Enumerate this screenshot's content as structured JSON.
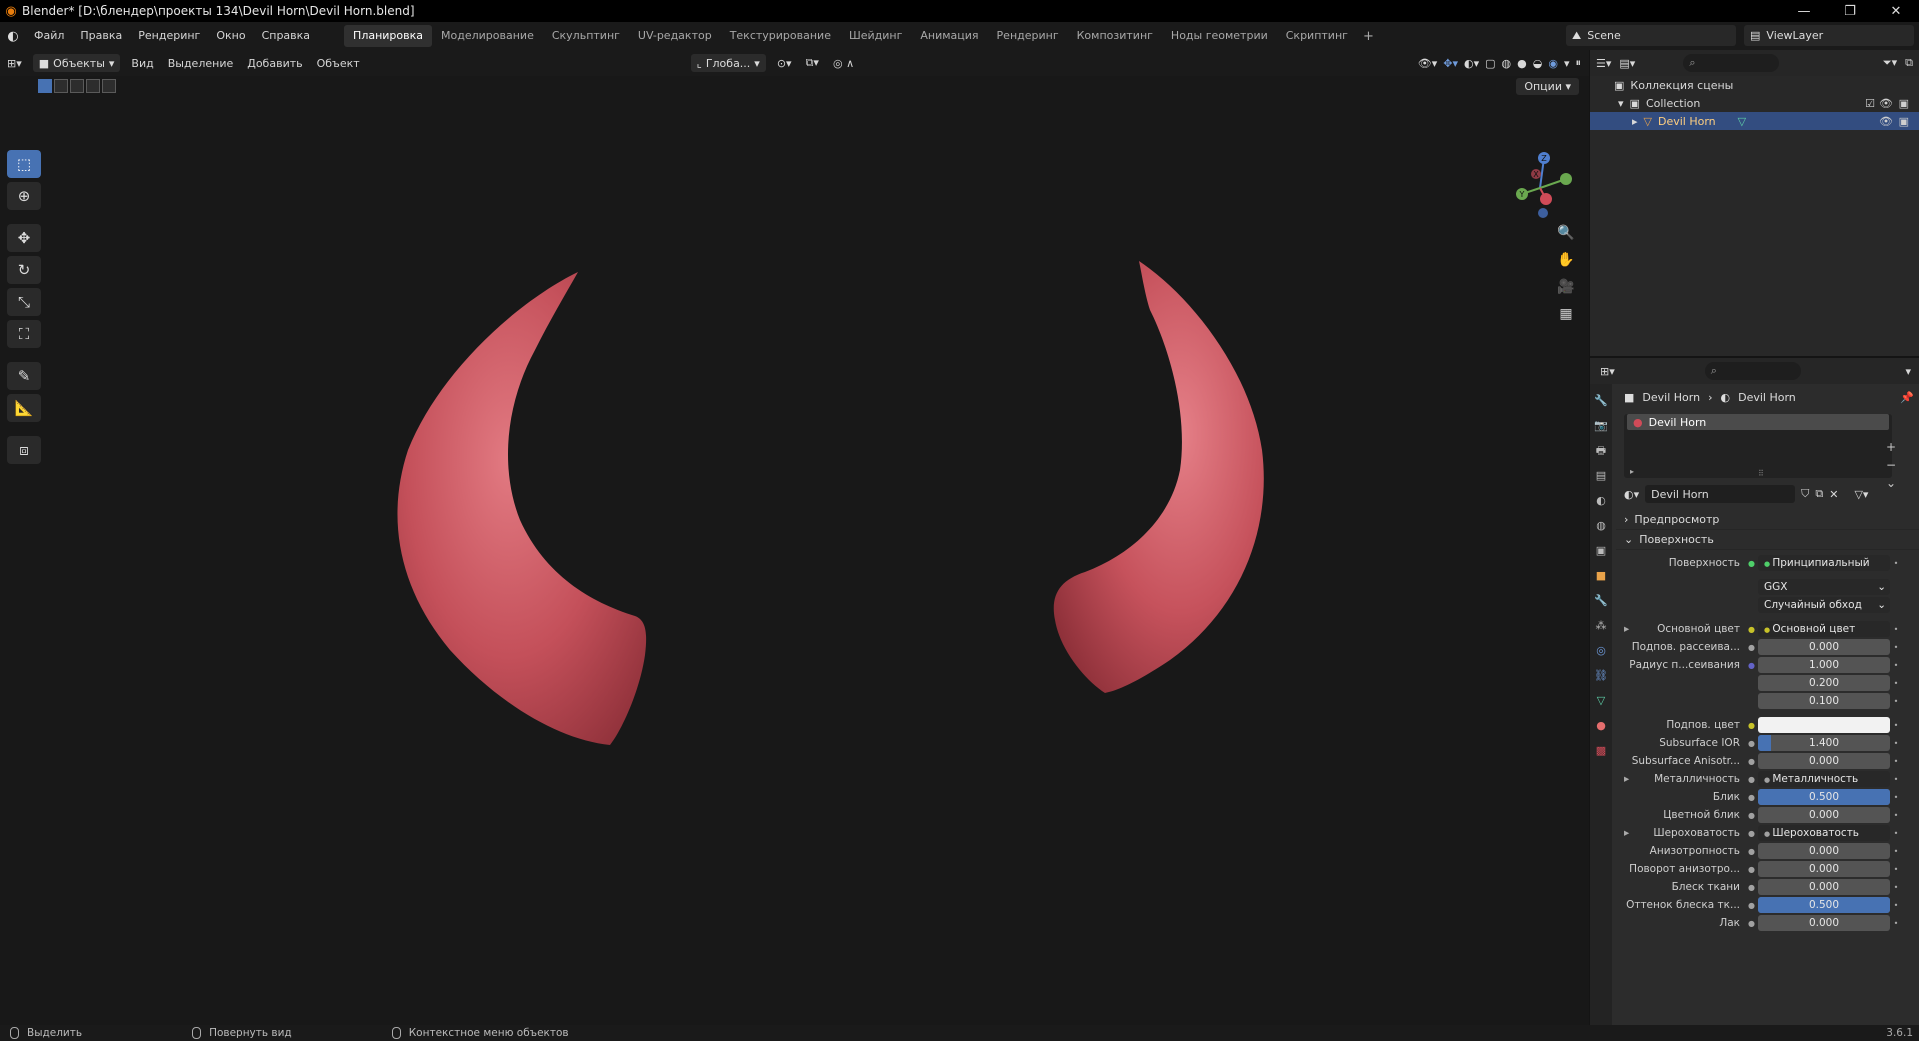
{
  "window": {
    "title": "Blender* [D:\\блендер\\проекты 134\\Devil Horn\\Devil Horn.blend]",
    "minimize": "—",
    "maximize": "❐",
    "close": "✕"
  },
  "menu": {
    "items": [
      "Файл",
      "Правка",
      "Рендеринг",
      "Окно",
      "Справка"
    ]
  },
  "workspaces": {
    "tabs": [
      "Планировка",
      "Моделирование",
      "Скульптинг",
      "UV-редактор",
      "Текстурирование",
      "Шейдинг",
      "Анимация",
      "Рендеринг",
      "Композитинг",
      "Ноды геометрии",
      "Скриптинг"
    ],
    "active": "Планировка",
    "add": "+"
  },
  "scene": {
    "label": "Scene"
  },
  "viewlayer": {
    "label": "ViewLayer"
  },
  "viewport_header": {
    "mode": "Объекты",
    "menus": [
      "Вид",
      "Выделение",
      "Добавить",
      "Объект"
    ],
    "transform_orientation": "Глоба...",
    "options": "Опции"
  },
  "gizmo": {
    "x": "X",
    "y": "Y",
    "z": "Z"
  },
  "outliner": {
    "rows": [
      "Коллекция сцены",
      "Collection",
      "Devil Horn"
    ]
  },
  "properties": {
    "breadcrumb": {
      "object": "Devil Horn",
      "material": "Devil Horn"
    },
    "material_slot": "Devil Horn",
    "material_name": "Devil Horn",
    "panels": {
      "preview": "Предпросмотр",
      "surface": "Поверхность"
    },
    "rows": [
      {
        "label": "Поверхность",
        "socket": "green",
        "value": "Принципиальный BSDF",
        "kind": "dark"
      },
      {
        "label": "",
        "socket": "",
        "value": "GGX",
        "kind": "dark-dd"
      },
      {
        "label": "",
        "socket": "",
        "value": "Случайный обход",
        "kind": "dark-dd"
      },
      {
        "label": "Основной цвет",
        "socket": "yellow",
        "value": "Основной цвет",
        "kind": "dark",
        "expand": true
      },
      {
        "label": "Подпов. рассеива...",
        "socket": "gray",
        "value": "0.000",
        "kind": "num",
        "fill": 0
      },
      {
        "label": "Радиус п...сеивания",
        "socket": "blue",
        "value": "1.000",
        "kind": "num",
        "fill": 0
      },
      {
        "label": "",
        "socket": "",
        "value": "0.200",
        "kind": "num",
        "fill": 0
      },
      {
        "label": "",
        "socket": "",
        "value": "0.100",
        "kind": "num",
        "fill": 0
      },
      {
        "label": "Подпов. цвет",
        "socket": "yellow",
        "value": "",
        "kind": "white"
      },
      {
        "label": "Subsurface IOR",
        "socket": "gray",
        "value": "1.400",
        "kind": "num",
        "fill": 0.1
      },
      {
        "label": "Subsurface Anisotr...",
        "socket": "gray",
        "value": "0.000",
        "kind": "num",
        "fill": 0
      },
      {
        "label": "Металличность",
        "socket": "gray",
        "value": "Металличность",
        "kind": "dark",
        "expand": true
      },
      {
        "label": "Блик",
        "socket": "gray",
        "value": "0.500",
        "kind": "num",
        "fill": 1
      },
      {
        "label": "Цветной блик",
        "socket": "gray",
        "value": "0.000",
        "kind": "num",
        "fill": 0
      },
      {
        "label": "Шероховатость",
        "socket": "gray",
        "value": "Шероховатость",
        "kind": "dark",
        "expand": true
      },
      {
        "label": "Анизотропность",
        "socket": "gray",
        "value": "0.000",
        "kind": "num",
        "fill": 0
      },
      {
        "label": "Поворот анизотро...",
        "socket": "gray",
        "value": "0.000",
        "kind": "num",
        "fill": 0
      },
      {
        "label": "Блеск ткани",
        "socket": "gray",
        "value": "0.000",
        "kind": "num",
        "fill": 0
      },
      {
        "label": "Оттенок блеска тк...",
        "socket": "gray",
        "value": "0.500",
        "kind": "num",
        "fill": 1
      },
      {
        "label": "Лак",
        "socket": "gray",
        "value": "0.000",
        "kind": "num",
        "fill": 0
      }
    ]
  },
  "statusbar": {
    "select": "Выделить",
    "rotate": "Повернуть вид",
    "context": "Контекстное меню объектов",
    "version": "3.6.1"
  },
  "colors": {
    "accent": "#4772b3",
    "horn": "#c4505a",
    "viewport_bg": "#181818"
  }
}
